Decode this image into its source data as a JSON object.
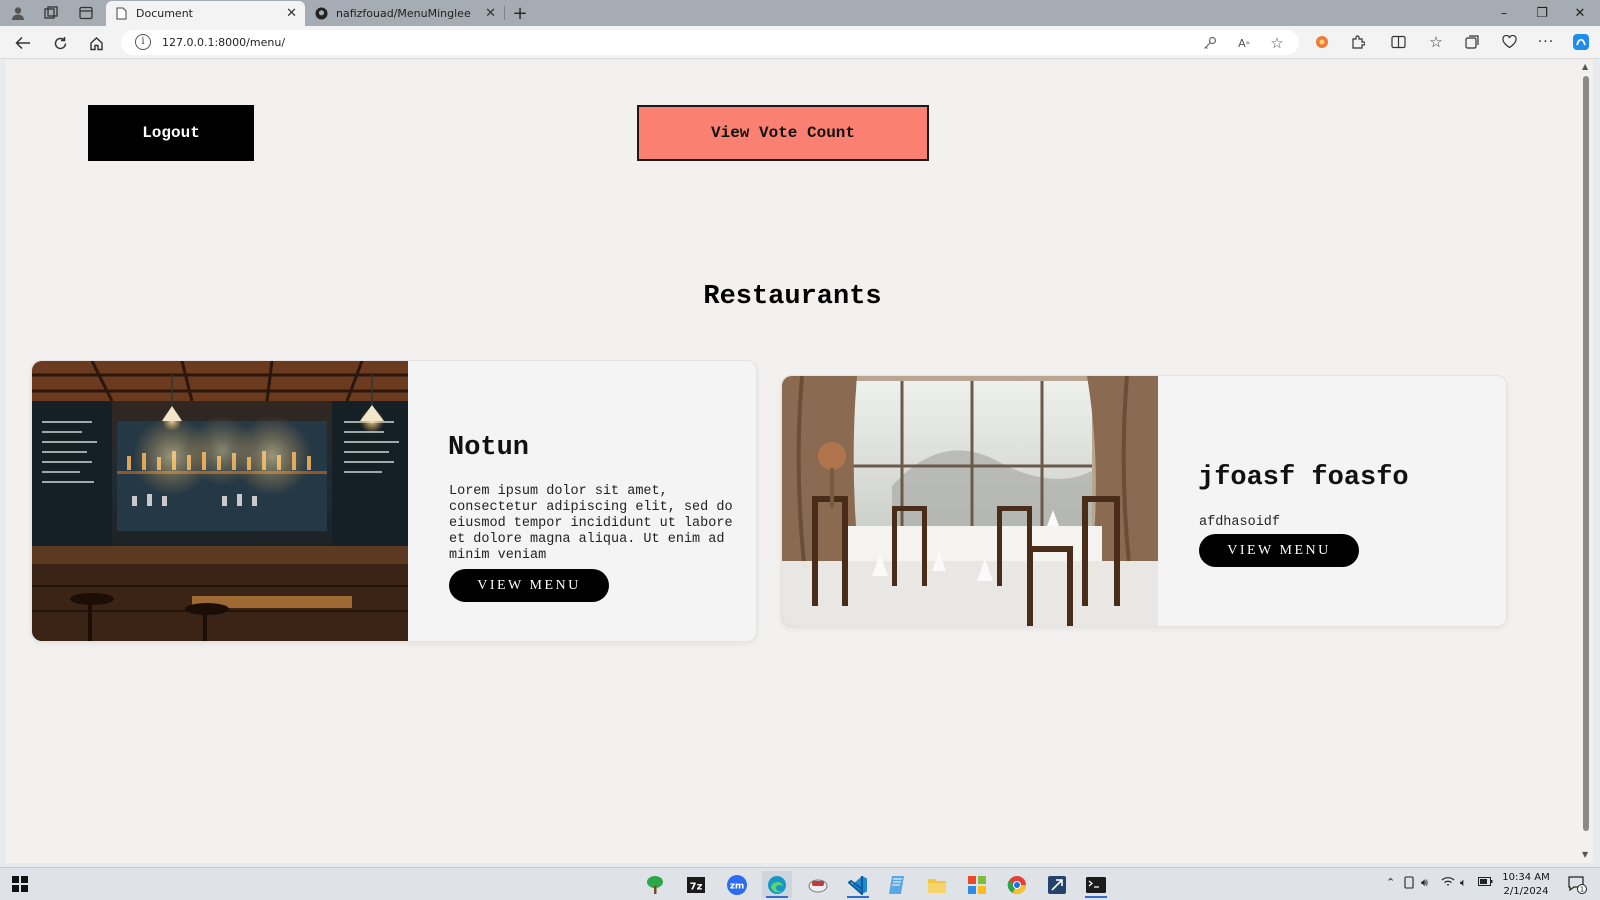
{
  "browser": {
    "tabs": [
      {
        "title": "Document",
        "active": true
      },
      {
        "title": "nafizfouad/MenuMinglee",
        "active": false
      }
    ],
    "new_tab_symbol": "+",
    "close_symbol": "✕",
    "url": "127.0.0.1:8000/menu/",
    "window_controls": {
      "minimize": "–",
      "restore": "❐",
      "close": "✕"
    }
  },
  "page": {
    "logout_label": "Logout",
    "vote_label": "View Vote Count",
    "section_title": "Restaurants",
    "restaurants": [
      {
        "name": "Notun",
        "description": "Lorem ipsum dolor sit amet, consectetur adipiscing elit, sed do eiusmod tempor incididunt ut labore et dolore magna aliqua. Ut enim ad minim veniam",
        "button": "VIEW MENU"
      },
      {
        "name": "jfoasf foasfo",
        "description": "afdhasoidf",
        "button": "VIEW MENU"
      }
    ]
  },
  "taskbar": {
    "apps": [
      "tree-app",
      "7zip",
      "zoom",
      "edge",
      "weather-app",
      "vscode",
      "notepad",
      "file-explorer",
      "office",
      "chrome",
      "blender",
      "terminal"
    ],
    "app_labels": {
      "zip": "7z",
      "zoom": "zm"
    },
    "time": "10:34 AM",
    "date": "2/1/2024",
    "notification_count": "1"
  },
  "colors": {
    "vote_button": "#fa8072",
    "page_background": "#f2f1ef",
    "card_background": "#f4f4f4",
    "tab_strip": "#a6acb3"
  }
}
